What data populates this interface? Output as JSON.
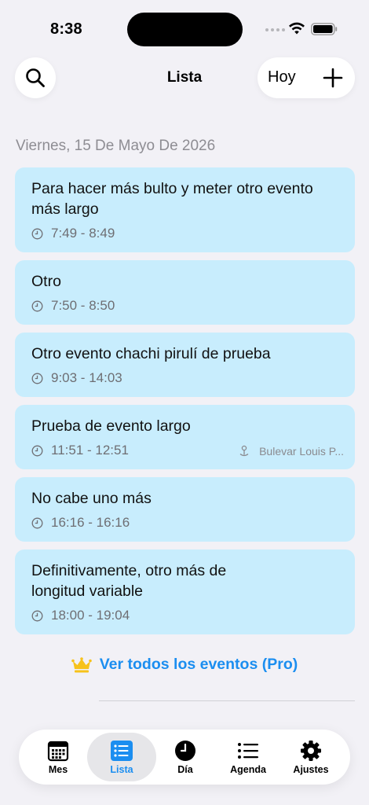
{
  "status_bar": {
    "time": "8:38"
  },
  "nav": {
    "title": "Lista",
    "today_label": "Hoy"
  },
  "date_header": "Viernes, 15 De Mayo De 2026",
  "events": [
    {
      "title": "Para hacer más bulto y meter otro evento más largo",
      "time": "7:49 - 8:49"
    },
    {
      "title": "Otro",
      "time": "7:50 - 8:50"
    },
    {
      "title": "Otro evento chachi pirulí de prueba",
      "time": "9:03 - 14:03"
    },
    {
      "title": "Prueba de evento largo",
      "time": "11:51 - 12:51",
      "location": "Bulevar Louis P..."
    },
    {
      "title": "No cabe uno más",
      "time": "16:16 - 16:16"
    },
    {
      "title": "Definitivamente, otro más de longitud variable",
      "time": "18:00 - 19:04"
    }
  ],
  "pro_link": {
    "label": "Ver todos los eventos (Pro)",
    "icon": "crown-icon"
  },
  "tabs": [
    {
      "label": "Mes",
      "icon": "calendar-icon",
      "active": false
    },
    {
      "label": "Lista",
      "icon": "list-icon",
      "active": true
    },
    {
      "label": "Día",
      "icon": "clock-icon",
      "active": false
    },
    {
      "label": "Agenda",
      "icon": "agenda-icon",
      "active": false
    },
    {
      "label": "Ajustes",
      "icon": "gear-icon",
      "active": false
    }
  ],
  "colors": {
    "accent": "#1b8ef0",
    "card": "#c8edfd",
    "crown": "#f7c21b",
    "background": "#f2f1f6"
  }
}
